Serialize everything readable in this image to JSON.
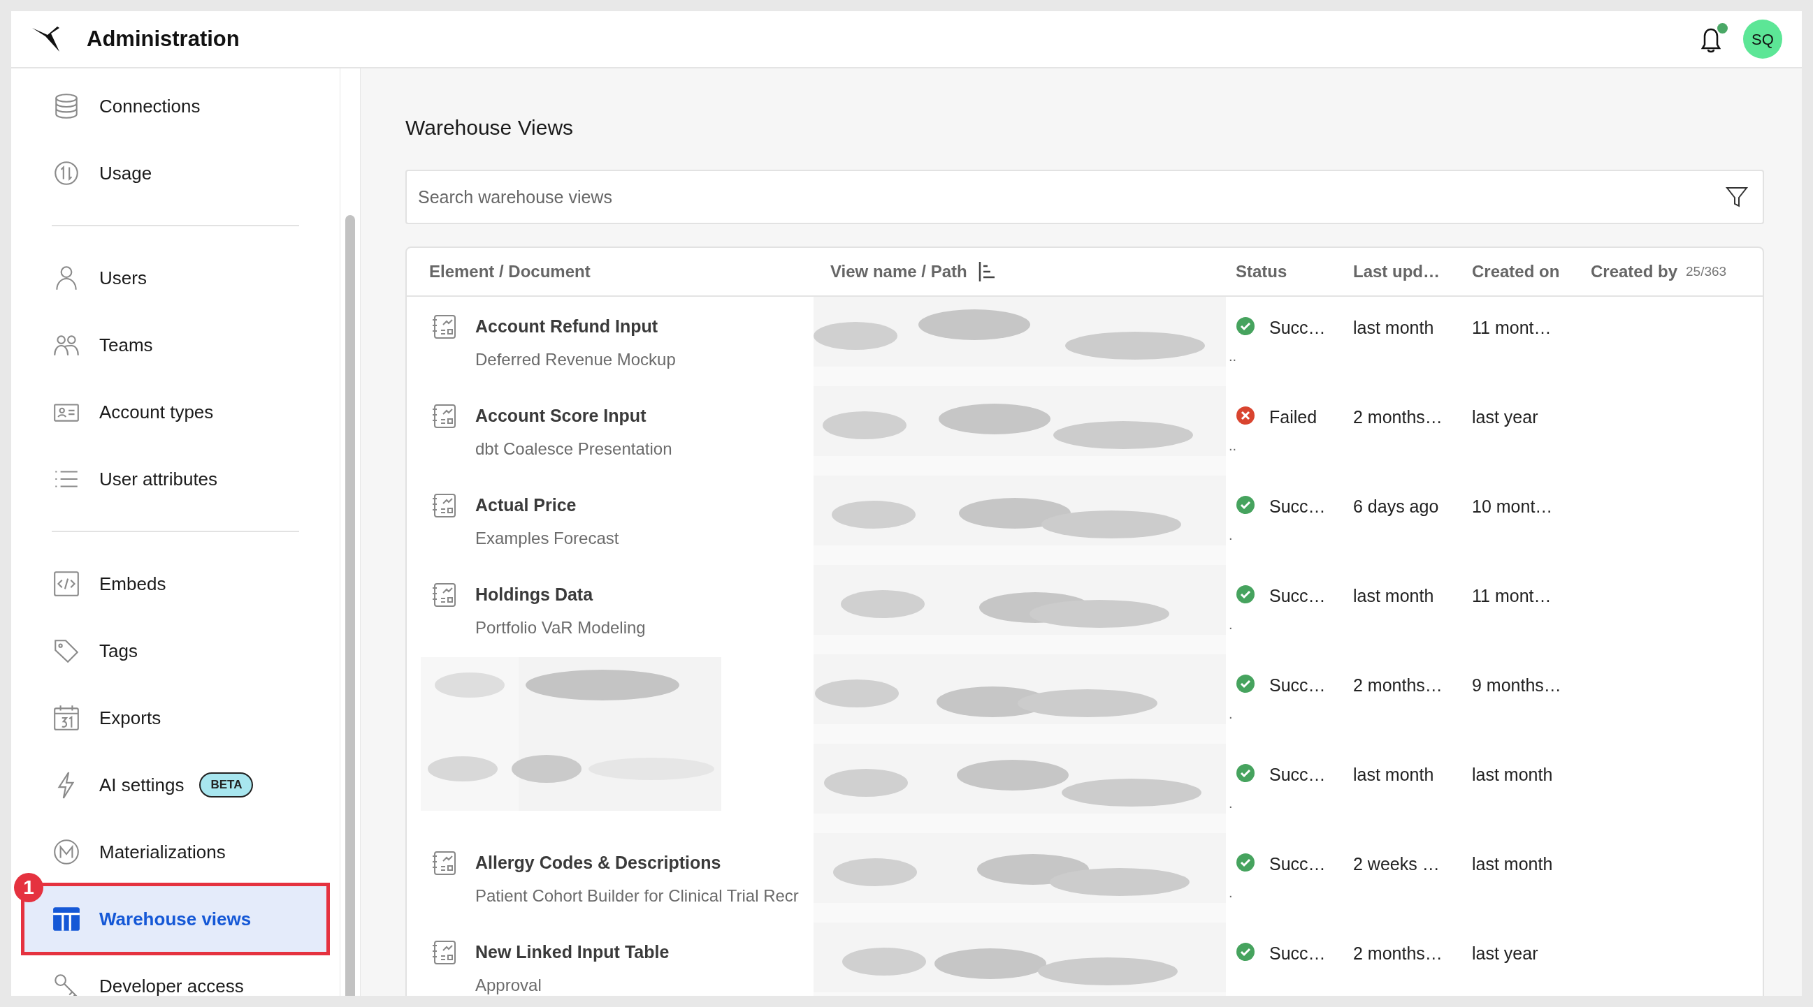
{
  "header": {
    "title": "Administration",
    "notifications_unread": true,
    "avatar_initials": "SQ"
  },
  "sidebar": {
    "groups": [
      [
        {
          "label": "Connections",
          "selected": false
        },
        {
          "label": "Usage",
          "selected": false
        }
      ],
      [
        {
          "label": "Users",
          "selected": false
        },
        {
          "label": "Teams",
          "selected": false
        },
        {
          "label": "Account types",
          "selected": false
        },
        {
          "label": "User attributes",
          "selected": false
        }
      ],
      [
        {
          "label": "Embeds",
          "selected": false
        },
        {
          "label": "Tags",
          "selected": false
        },
        {
          "label": "Exports",
          "selected": false
        },
        {
          "label": "AI settings",
          "selected": false,
          "badge": "BETA"
        },
        {
          "label": "Materializations",
          "selected": false
        },
        {
          "label": "Warehouse views",
          "selected": true,
          "callout": "1"
        },
        {
          "label": "Developer access",
          "selected": false
        }
      ]
    ]
  },
  "main": {
    "title": "Warehouse Views",
    "search": {
      "placeholder": "Search warehouse views"
    },
    "table": {
      "columns": [
        "Element / Document",
        "View name / Path",
        "Status",
        "Last upd…",
        "Created on",
        "Created by"
      ],
      "count": "25/363",
      "rows": [
        {
          "element": "Account Refund Input",
          "document": "Deferred Revenue Mockup",
          "path_tail": "..",
          "kind": "success",
          "status_text": "Succ…",
          "last_updated": "last month",
          "created_on": "11 mont…"
        },
        {
          "element": "Account Score Input",
          "document": "dbt Coalesce Presentation",
          "path_tail": "..",
          "kind": "failed",
          "status_text": "Failed",
          "last_updated": "2 months…",
          "created_on": "last year"
        },
        {
          "element": "Actual Price",
          "document": "Examples Forecast",
          "path_tail": ".",
          "kind": "success",
          "status_text": "Succ…",
          "last_updated": "6 days ago",
          "created_on": "10 mont…"
        },
        {
          "element": "Holdings Data",
          "document": "Portfolio VaR Modeling",
          "path_tail": ".",
          "kind": "success",
          "status_text": "Succ…",
          "last_updated": "last month",
          "created_on": "11 mont…"
        },
        {
          "path_tail": ".",
          "kind": "success",
          "status_text": "Succ…",
          "last_updated": "2 months…",
          "created_on": "9 months…"
        },
        {
          "path_tail": ".",
          "kind": "success",
          "status_text": "Succ…",
          "last_updated": "last month",
          "created_on": "last month"
        },
        {
          "element": "Allergy Codes & Descriptions",
          "document": "Patient Cohort Builder for Clinical Trial Recr",
          "path_tail": ".",
          "kind": "success",
          "status_text": "Succ…",
          "last_updated": "2 weeks …",
          "created_on": "last month"
        },
        {
          "element": "New Linked Input Table",
          "document": "Approval",
          "kind": "success",
          "status_text": "Succ…",
          "last_updated": "2 months…",
          "created_on": "last year"
        }
      ]
    }
  }
}
